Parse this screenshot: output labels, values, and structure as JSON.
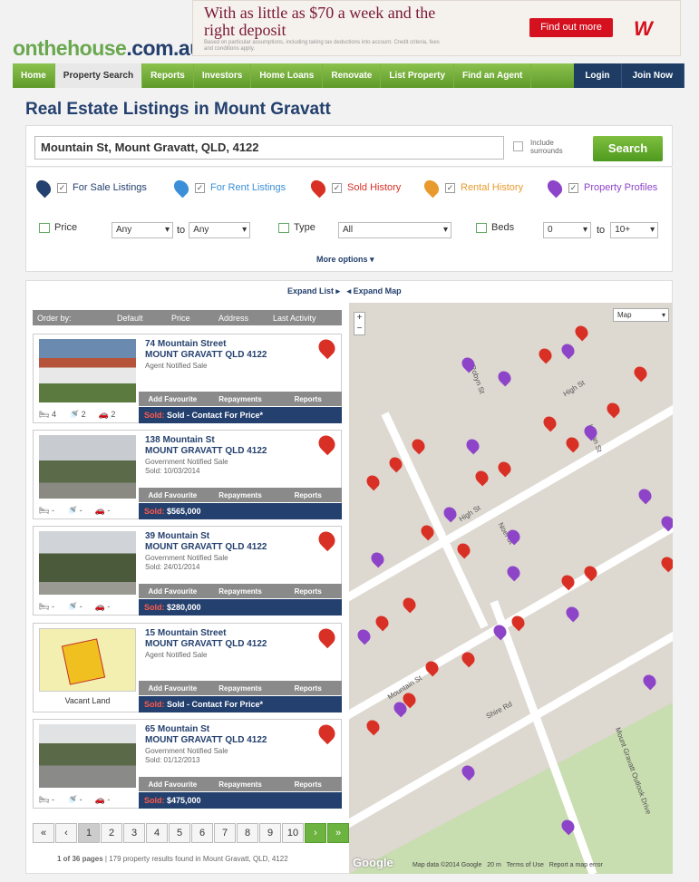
{
  "header": {
    "logo_main": "onthehouse",
    "logo_ext": ".com.au",
    "ad": {
      "headline": "With as little as $70 a week and the right deposit",
      "small": "Based on particular assumptions, including taking tax deductions into account. Credit criteria, fees and conditions apply.",
      "button": "Find out more"
    }
  },
  "nav": {
    "items": [
      "Home",
      "Property Search",
      "Reports",
      "Investors",
      "Home Loans",
      "Renovate",
      "List Property",
      "Find an Agent"
    ],
    "login": "Login",
    "join": "Join Now"
  },
  "page": {
    "title": "Real Estate Listings in Mount Gravatt"
  },
  "search": {
    "value": "Mountain St, Mount Gravatt, QLD, 4122",
    "surrounds": "Include surrounds",
    "button": "Search"
  },
  "listing_types": [
    {
      "label": "For Sale Listings",
      "color": "#24406e"
    },
    {
      "label": "For Rent Listings",
      "color": "#3a8fd8"
    },
    {
      "label": "Sold History",
      "color": "#d93025"
    },
    {
      "label": "Rental History",
      "color": "#e89a2c"
    },
    {
      "label": "Property Profiles",
      "color": "#8e44c9"
    }
  ],
  "filters": {
    "price_label": "Price",
    "price_min": "Any",
    "to": "to",
    "price_max": "Any",
    "type_label": "Type",
    "type_value": "All",
    "beds_label": "Beds",
    "beds_min": "0",
    "beds_max": "10+",
    "more": "More options"
  },
  "list": {
    "expand_list": "Expand List",
    "expand_map": "Expand Map",
    "order": {
      "label": "Order by:",
      "options": [
        "Default",
        "Price",
        "Address",
        "Last Activity"
      ]
    },
    "actions": {
      "fav": "Add Favourite",
      "rep": "Repayments",
      "reports": "Reports"
    },
    "sold_prefix": "Sold:",
    "cards": [
      {
        "street": "74 Mountain Street",
        "suburb": "MOUNT GRAVATT QLD 4122",
        "note": "Agent Notified Sale",
        "date": "",
        "price": "Sold - Contact For Price*",
        "beds": "4",
        "baths": "2",
        "cars": "2"
      },
      {
        "street": "138 Mountain St",
        "suburb": "MOUNT GRAVATT QLD 4122",
        "note": "Government Notified Sale",
        "date": "Sold: 10/03/2014",
        "price": "$565,000",
        "beds": "-",
        "baths": "-",
        "cars": "-"
      },
      {
        "street": "39 Mountain St",
        "suburb": "MOUNT GRAVATT QLD 4122",
        "note": "Government Notified Sale",
        "date": "Sold: 24/01/2014",
        "price": "$280,000",
        "beds": "-",
        "baths": "-",
        "cars": "-"
      },
      {
        "street": "15 Mountain Street",
        "suburb": "MOUNT GRAVATT QLD 4122",
        "note": "Agent Notified Sale",
        "date": "",
        "price": "Sold - Contact For Price*",
        "vacant": "Vacant Land"
      },
      {
        "street": "65 Mountain St",
        "suburb": "MOUNT GRAVATT QLD 4122",
        "note": "Government Notified Sale",
        "date": "Sold: 01/12/2013",
        "price": "$475,000",
        "beds": "-",
        "baths": "-",
        "cars": "-"
      }
    ]
  },
  "pager": {
    "pages": [
      "1",
      "2",
      "3",
      "4",
      "5",
      "6",
      "7",
      "8",
      "9",
      "10"
    ],
    "info_bold": "1 of 36 pages",
    "info": " | 179 property results found in Mount Gravatt, QLD, 4122"
  },
  "map": {
    "type": "Map",
    "streets": [
      "High St",
      "Noel St",
      "Mountain St",
      "Shire Rd",
      "Mount Gravatt Outlook Drive",
      "Robyn St",
      "Logan St"
    ],
    "google": "Google",
    "data": "Map data ©2014 Google",
    "scale": "20 m",
    "terms": "Terms of Use",
    "report": "Report a map error"
  }
}
